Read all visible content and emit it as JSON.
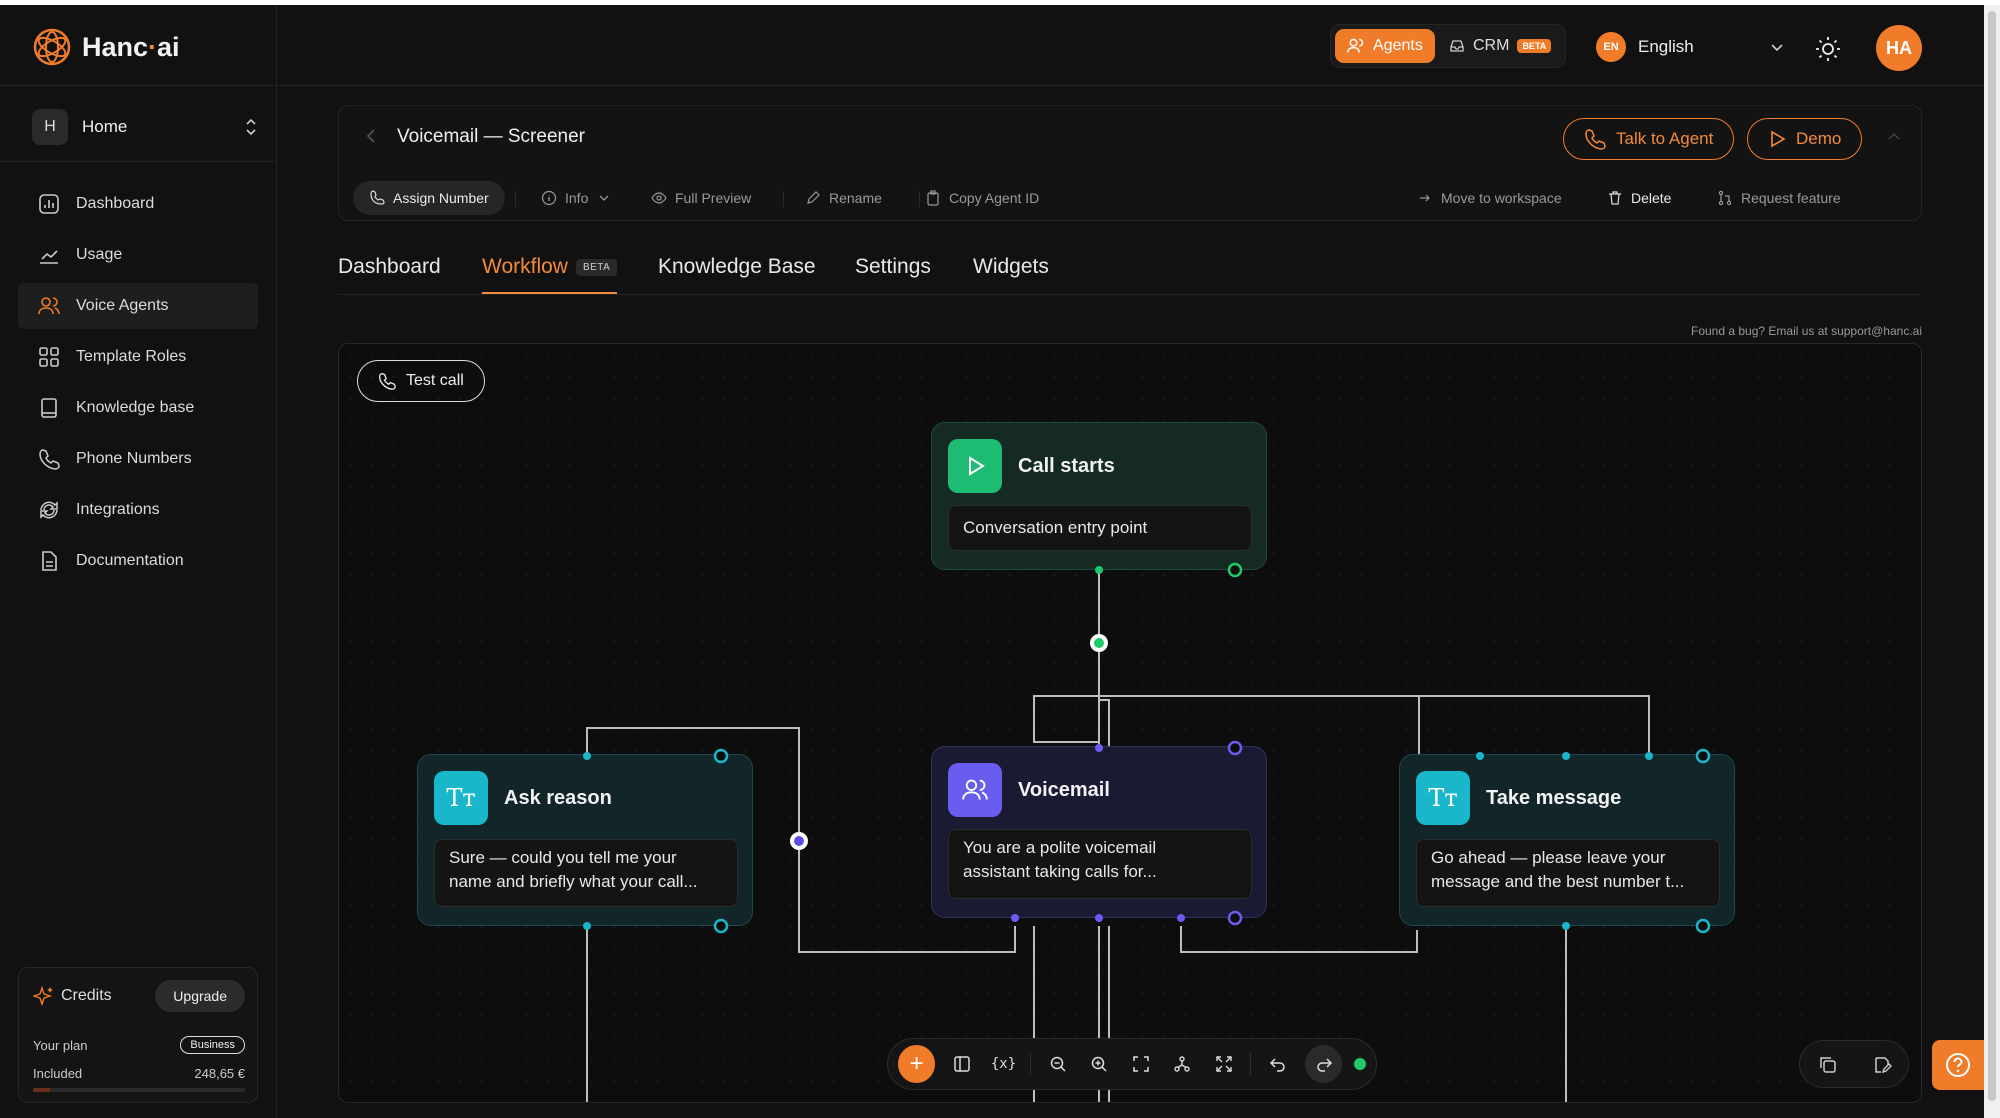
{
  "brand": {
    "name_a": "Hanc",
    "name_dot": "·",
    "name_b": "ai"
  },
  "workspace": {
    "initial": "H",
    "name": "Home"
  },
  "nav": [
    {
      "label": "Dashboard",
      "icon": "dashboard-icon"
    },
    {
      "label": "Usage",
      "icon": "chart-line-icon"
    },
    {
      "label": "Voice Agents",
      "icon": "users-icon",
      "active": true
    },
    {
      "label": "Template Roles",
      "icon": "grid-icon"
    },
    {
      "label": "Knowledge base",
      "icon": "book-icon"
    },
    {
      "label": "Phone Numbers",
      "icon": "phone-icon"
    },
    {
      "label": "Integrations",
      "icon": "sync-icon"
    },
    {
      "label": "Documentation",
      "icon": "document-icon"
    }
  ],
  "credits": {
    "label": "Credits",
    "upgrade": "Upgrade",
    "plan_label": "Your plan",
    "plan": "Business",
    "included_label": "Included",
    "included_value": "248,65 €",
    "usage_fraction": 0.08
  },
  "header": {
    "agents": "Agents",
    "crm": "CRM",
    "crm_badge": "BETA",
    "lang_code": "EN",
    "lang": "English",
    "avatar": "HA"
  },
  "agent": {
    "title": "Voicemail — Screener",
    "talk": "Talk to Agent",
    "demo": "Demo",
    "toolbar": {
      "assign": "Assign Number",
      "info": "Info",
      "preview": "Full Preview",
      "rename": "Rename",
      "copy": "Copy Agent ID",
      "move": "Move to workspace",
      "delete": "Delete",
      "request": "Request feature"
    }
  },
  "tabs": [
    {
      "label": "Dashboard"
    },
    {
      "label": "Workflow",
      "badge": "BETA",
      "active": true
    },
    {
      "label": "Knowledge Base"
    },
    {
      "label": "Settings"
    },
    {
      "label": "Widgets"
    }
  ],
  "bug_note": "Found a bug? Email us at support@hanc.ai",
  "canvas": {
    "test_call": "Test call",
    "nodes": {
      "call": {
        "title": "Call starts",
        "body": "Conversation entry point"
      },
      "ask": {
        "title": "Ask reason",
        "body_1": "Sure — could you tell me your",
        "body_2": "name and briefly what your call..."
      },
      "voice": {
        "title": "Voicemail",
        "body_1": "You are a polite voicemail",
        "body_2": "assistant taking calls for..."
      },
      "take": {
        "title": "Take message",
        "body_1": "Go ahead — please leave your",
        "body_2": "message and the best number t..."
      }
    },
    "toolbar_var": "{x}"
  },
  "colors": {
    "accent": "#f07c2a",
    "green": "#1ec96b",
    "teal": "#19b7c9",
    "purple": "#6b5cf0"
  }
}
